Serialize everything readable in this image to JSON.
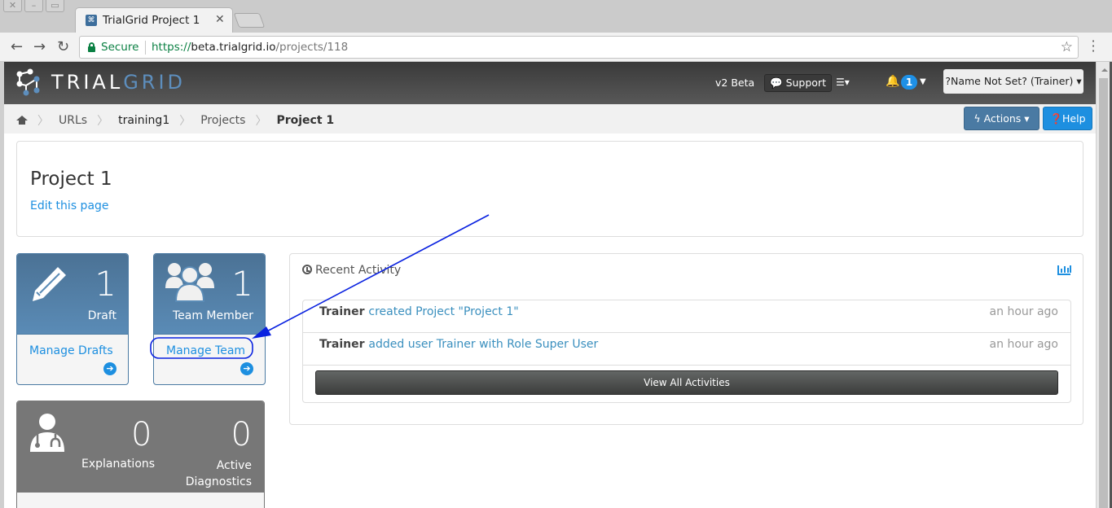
{
  "browser": {
    "window_controls": [
      "close",
      "minimize",
      "maximize"
    ],
    "tab_title": "TrialGrid Project 1",
    "security_label": "Secure",
    "url_scheme": "https://",
    "url_host": "beta.trialgrid.io",
    "url_path": "/projects/118"
  },
  "navbar": {
    "logo_trial": "TRIAL",
    "logo_grid": "GRID",
    "beta_label": "v2 Beta",
    "support_label": "Support",
    "notification_count": "1",
    "user_label": "?Name Not Set? (Trainer)"
  },
  "breadcrumb": {
    "items": [
      "URLs",
      "training1",
      "Projects",
      "Project 1"
    ]
  },
  "page_actions": {
    "actions_label": "Actions",
    "help_label": "Help"
  },
  "header": {
    "title": "Project 1",
    "edit_link": "Edit this page"
  },
  "cards": {
    "drafts": {
      "count": "1",
      "label": "Draft",
      "link": "Manage Drafts"
    },
    "team": {
      "count": "1",
      "label": "Team Member",
      "link": "Manage Team"
    },
    "diagnostics": {
      "explanations_count": "0",
      "explanations_label": "Explanations",
      "active_count": "0",
      "active_label_line1": "Active",
      "active_label_line2": "Diagnostics"
    }
  },
  "activity": {
    "title": "Recent Activity",
    "items": [
      {
        "who": "Trainer",
        "what": "created Project \"Project 1\"",
        "when": "an hour ago"
      },
      {
        "who": "Trainer",
        "what": "added user Trainer with Role Super User",
        "when": "an hour ago"
      }
    ],
    "view_all_label": "View All Activities"
  },
  "annotation": {
    "color": "#0a22e0",
    "target": "Manage Team"
  }
}
